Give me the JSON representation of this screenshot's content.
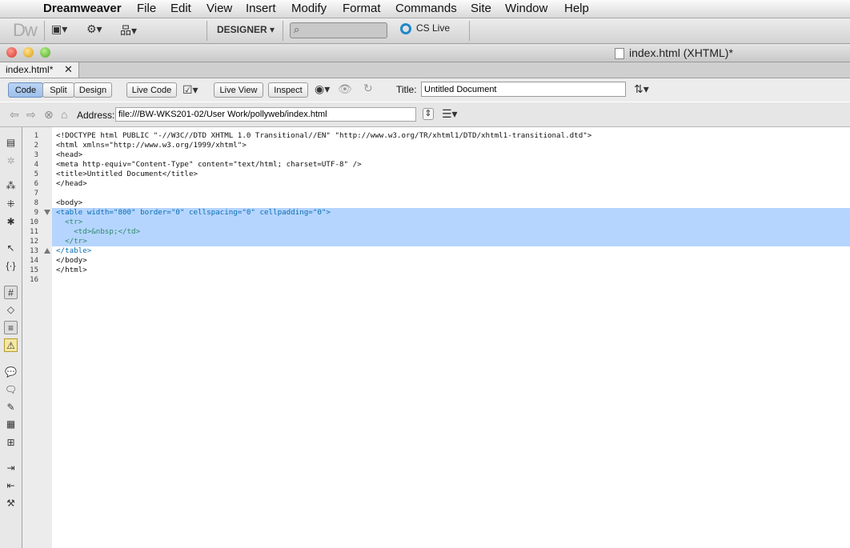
{
  "menubar": {
    "app": "Dreamweaver",
    "items": [
      "File",
      "Edit",
      "View",
      "Insert",
      "Modify",
      "Format",
      "Commands",
      "Site",
      "Window",
      "Help"
    ]
  },
  "app_toolbar": {
    "logo": "Dw",
    "workspace": "DESIGNER",
    "cs_live": "CS Live"
  },
  "window": {
    "title": "index.html (XHTML)*"
  },
  "tab": {
    "label": "index.html*",
    "close": "✕"
  },
  "doc_toolbar": {
    "code": "Code",
    "split": "Split",
    "design": "Design",
    "live_code": "Live Code",
    "live_view": "Live View",
    "inspect": "Inspect",
    "title_label": "Title:",
    "title_value": "Untitled Document"
  },
  "address": {
    "label": "Address:",
    "value": "file:///BW-WKS201-02/User Work/pollyweb/index.html"
  },
  "code_lines": [
    "<!DOCTYPE html PUBLIC \"-//W3C//DTD XHTML 1.0 Transitional//EN\" \"http://www.w3.org/TR/xhtml1/DTD/xhtml1-transitional.dtd\">",
    "<html xmlns=\"http://www.w3.org/1999/xhtml\">",
    "<head>",
    "<meta http-equiv=\"Content-Type\" content=\"text/html; charset=UTF-8\" />",
    "<title>Untitled Document</title>",
    "</head>",
    "",
    "<body>",
    "<table width=\"800\" border=\"0\" cellspacing=\"0\" cellpadding=\"0\">",
    "  <tr>",
    "    <td>&nbsp;</td>",
    "  </tr>",
    "</table>",
    "</body>",
    "</html>",
    ""
  ],
  "line_numbers": [
    "1",
    "2",
    "3",
    "4",
    "5",
    "6",
    "7",
    "8",
    "9",
    "10",
    "11",
    "12",
    "13",
    "14",
    "15",
    "16"
  ],
  "colors": {
    "selection": "#b5d5ff",
    "tag_blue": "#0b6fb3",
    "attr_green": "#2e8a6b",
    "active_seg": "#9cc0ec"
  }
}
